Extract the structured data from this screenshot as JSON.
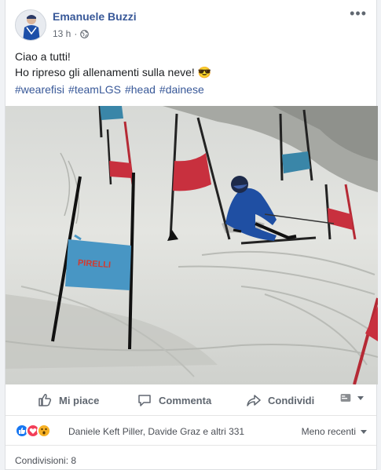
{
  "post": {
    "author": "Emanuele Buzzi",
    "time": "13 h",
    "privacy_icon": "globe-icon",
    "more_icon": "more-options-icon",
    "text_line1": "Ciao a tutti!",
    "text_line2": "Ho ripreso gli allenamenti sulla neve! 😎",
    "hashtags": [
      "#wearefisi",
      "#teamLGS",
      "#head",
      "#dainese"
    ],
    "photo_banner_text": "PIRELLI"
  },
  "actions": {
    "like": "Mi piace",
    "comment": "Commenta",
    "share": "Condividi"
  },
  "reactions": {
    "icons": [
      "like-reaction-icon",
      "love-reaction-icon",
      "wow-reaction-icon"
    ],
    "likers": "Daniele Keft Piller, Davide Graz e altri 331",
    "sort_label": "Meno recenti"
  },
  "shares": "Condivisioni: 8",
  "colors": {
    "link": "#385898",
    "like_blue": "#1877f2",
    "love_red": "#f33e58",
    "wow_yellow": "#f7b125"
  }
}
